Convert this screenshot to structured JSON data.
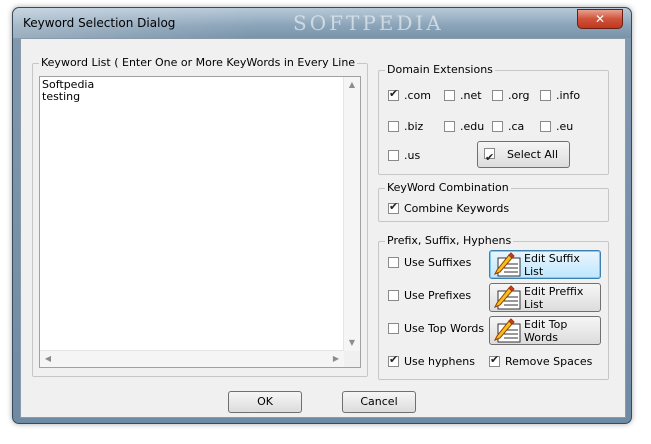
{
  "window": {
    "title": "Keyword Selection Dialog",
    "watermark": "SOFTPEDIA",
    "close_symbol": "✕"
  },
  "keyword_list": {
    "legend": "Keyword List ( Enter One or More KeyWords in Every Line",
    "lines": [
      "Softpedia",
      "testing"
    ]
  },
  "domain_extensions": {
    "legend": "Domain Extensions",
    "items": [
      {
        "label": ".com",
        "checked": true
      },
      {
        "label": ".net",
        "checked": false
      },
      {
        "label": ".org",
        "checked": false
      },
      {
        "label": ".info",
        "checked": false
      },
      {
        "label": ".biz",
        "checked": false
      },
      {
        "label": ".edu",
        "checked": false
      },
      {
        "label": ".ca",
        "checked": false
      },
      {
        "label": ".eu",
        "checked": false
      },
      {
        "label": ".us",
        "checked": false
      }
    ],
    "select_all_label": "Select All",
    "select_all_checked": true
  },
  "keyword_combination": {
    "legend": "KeyWord Combination",
    "combine_label": "Combine Keywords",
    "combine_checked": true
  },
  "prefix_suffix": {
    "legend": "Prefix, Suffix, Hyphens",
    "use_suffixes": {
      "label": "Use Suffixes",
      "checked": false
    },
    "use_prefixes": {
      "label": "Use Prefixes",
      "checked": false
    },
    "use_top_words": {
      "label": "Use Top Words",
      "checked": false
    },
    "use_hyphens": {
      "label": "Use hyphens",
      "checked": true
    },
    "remove_spaces": {
      "label": "Remove Spaces",
      "checked": true
    },
    "edit_suffix_label": "Edit Suffix List",
    "edit_prefix_label": "Edit Preffix List",
    "edit_top_words_label": "Edit Top Words",
    "icon": "notepad-pencil-icon"
  },
  "footer": {
    "ok_label": "OK",
    "cancel_label": "Cancel"
  }
}
